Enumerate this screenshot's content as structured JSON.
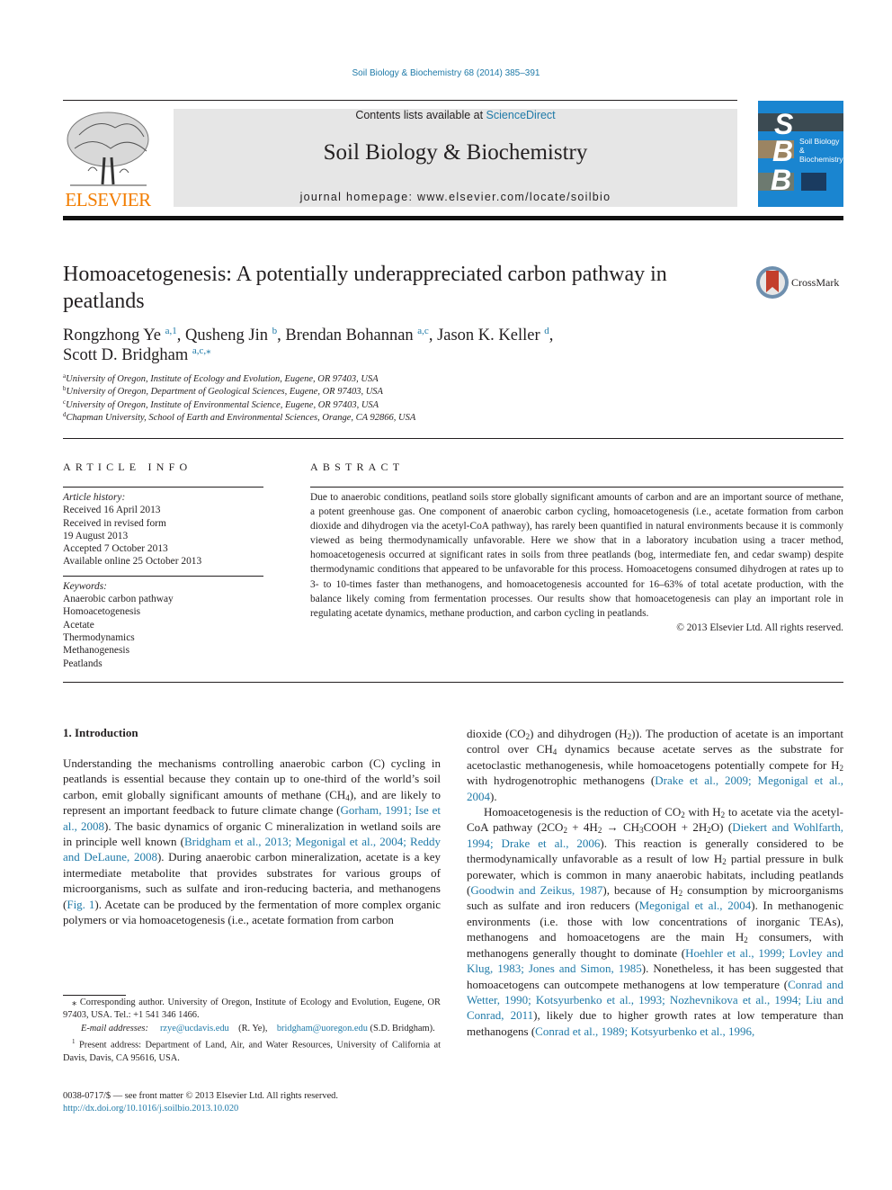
{
  "journal_citation": "Soil Biology & Biochemistry 68 (2014) 385–391",
  "header": {
    "contents_prefix": "Contents lists available at ",
    "contents_link": "ScienceDirect",
    "journal_title": "Soil Biology & Biochemistry",
    "homepage": "journal homepage: www.elsevier.com/locate/soilbio",
    "publisher": "ELSEVIER",
    "cover": {
      "letters": [
        "S",
        "B",
        "B"
      ],
      "title_line1": "Soil Biology &",
      "title_line2": "Biochemistry",
      "color": "#1a85d0"
    }
  },
  "crossmark_label": "CrossMark",
  "article": {
    "title": "Homoacetogenesis: A potentially underappreciated carbon pathway in peatlands",
    "authors": [
      {
        "name": "Rongzhong Ye",
        "marks": "a,1",
        "sep": ", "
      },
      {
        "name": "Qusheng Jin",
        "marks": "b",
        "sep": ", "
      },
      {
        "name": "Brendan Bohannan",
        "marks": "a,c",
        "sep": ", "
      },
      {
        "name": "Jason K. Keller",
        "marks": "d",
        "sep": ","
      },
      {
        "name": "Scott D. Bridgham",
        "marks": "a,c,⁎",
        "sep": ""
      }
    ],
    "affiliations": [
      {
        "mark": "a",
        "text": "University of Oregon, Institute of Ecology and Evolution, Eugene, OR 97403, USA"
      },
      {
        "mark": "b",
        "text": "University of Oregon, Department of Geological Sciences, Eugene, OR 97403, USA"
      },
      {
        "mark": "c",
        "text": "University of Oregon, Institute of Environmental Science, Eugene, OR 97403, USA"
      },
      {
        "mark": "d",
        "text": "Chapman University, School of Earth and Environmental Sciences, Orange, CA 92866, USA"
      }
    ]
  },
  "article_info": {
    "heading": "ARTICLE INFO",
    "history_label": "Article history:",
    "history": [
      "Received 16 April 2013",
      "Received in revised form",
      "19 August 2013",
      "Accepted 7 October 2013",
      "Available online 25 October 2013"
    ],
    "keywords_label": "Keywords:",
    "keywords": [
      "Anaerobic carbon pathway",
      "Homoacetogenesis",
      "Acetate",
      "Thermodynamics",
      "Methanogenesis",
      "Peatlands"
    ]
  },
  "abstract": {
    "heading": "ABSTRACT",
    "text": "Due to anaerobic conditions, peatland soils store globally significant amounts of carbon and are an important source of methane, a potent greenhouse gas. One component of anaerobic carbon cycling, homoacetogenesis (i.e., acetate formation from carbon dioxide and dihydrogen via the acetyl-CoA pathway), has rarely been quantified in natural environments because it is commonly viewed as being thermodynamically unfavorable. Here we show that in a laboratory incubation using a tracer method, homoacetogenesis occurred at significant rates in soils from three peatlands (bog, intermediate fen, and cedar swamp) despite thermodynamic conditions that appeared to be unfavorable for this process. Homoacetogens consumed dihydrogen at rates up to 3- to 10-times faster than methanogens, and homoacetogenesis accounted for 16–63% of total acetate production, with the balance likely coming from fermentation processes. Our results show that homoacetogenesis can play an important role in regulating acetate dynamics, methane production, and carbon cycling in peatlands.",
    "copyright": "© 2013 Elsevier Ltd. All rights reserved."
  },
  "intro": {
    "heading": "1.  Introduction",
    "p1": [
      {
        "t": "Understanding the mechanisms controlling anaerobic carbon (C) cycling in peatlands is essential because they contain up to one-third of the world’s soil carbon, emit globally significant amounts of methane (CH"
      },
      {
        "sub": "4"
      },
      {
        "t": "), and are likely to represent an important feedback to future climate change ("
      },
      {
        "link": "Gorham, 1991; Ise et al., 2008"
      },
      {
        "t": "). The basic dynamics of organic C mineralization in wetland soils are in principle well known ("
      },
      {
        "link": "Bridgham et al., 2013; Megonigal et al., 2004; Reddy and DeLaune, 2008"
      },
      {
        "t": "). During anaerobic carbon mineralization, acetate is a key intermediate metabolite that provides substrates for various groups of microorganisms, such as sulfate and iron-reducing bacteria, and methanogens ("
      },
      {
        "link": "Fig. 1"
      },
      {
        "t": "). Acetate can be produced by the fermentation of more complex organic polymers or via homoacetogenesis (i.e., acetate formation from carbon"
      }
    ],
    "col2_p1": [
      {
        "t": "dioxide (CO"
      },
      {
        "sub": "2"
      },
      {
        "t": ") and dihydrogen (H"
      },
      {
        "sub": "2"
      },
      {
        "t": ")). The production of acetate is an important control over CH"
      },
      {
        "sub": "4"
      },
      {
        "t": " dynamics because acetate serves as the substrate for acetoclastic methanogenesis, while homoacetogens potentially compete for H"
      },
      {
        "sub": "2"
      },
      {
        "t": " with hydrogenotrophic methanogens ("
      },
      {
        "link": "Drake et al., 2009; Megonigal et al., 2004"
      },
      {
        "t": ")."
      }
    ],
    "col2_p2": [
      {
        "t": "Homoacetogenesis is the reduction of CO"
      },
      {
        "sub": "2"
      },
      {
        "t": " with H"
      },
      {
        "sub": "2"
      },
      {
        "t": " to acetate via the acetyl-CoA pathway (2CO"
      },
      {
        "sub": "2"
      },
      {
        "t": " + 4H"
      },
      {
        "sub": "2"
      },
      {
        "t": " → CH"
      },
      {
        "sub": "3"
      },
      {
        "t": "COOH + 2H"
      },
      {
        "sub": "2"
      },
      {
        "t": "O) ("
      },
      {
        "link": "Diekert and Wohlfarth, 1994; Drake et al., 2006"
      },
      {
        "t": "). This reaction is generally considered to be thermodynamically unfavorable as a result of low H"
      },
      {
        "sub": "2"
      },
      {
        "t": " partial pressure in bulk porewater, which is common in many anaerobic habitats, including peatlands ("
      },
      {
        "link": "Goodwin and Zeikus, 1987"
      },
      {
        "t": "), because of H"
      },
      {
        "sub": "2"
      },
      {
        "t": " consumption by microorganisms such as sulfate and iron reducers ("
      },
      {
        "link": "Megonigal et al., 2004"
      },
      {
        "t": "). In methanogenic environments (i.e. those with low concentrations of inorganic TEAs), methanogens and homoacetogens are the main H"
      },
      {
        "sub": "2"
      },
      {
        "t": " consumers, with methanogens generally thought to dominate ("
      },
      {
        "link": "Hoehler et al., 1999; Lovley and Klug, 1983; Jones and Simon, 1985"
      },
      {
        "t": "). Nonetheless, it has been suggested that homoacetogens can outcompete methanogens at low temperature ("
      },
      {
        "link": "Conrad and Wetter, 1990; Kotsyurbenko et al., 1993; Nozhevnikova et al., 1994; Liu and Conrad, 2011"
      },
      {
        "t": "), likely due to higher growth rates at low temperature than methanogens ("
      },
      {
        "link": "Conrad et al., 1989; Kotsyurbenko et al., 1996,"
      }
    ]
  },
  "footnotes": {
    "corresponding": "⁎ Corresponding author. University of Oregon, Institute of Ecology and Evolution, Eugene, OR 97403, USA. Tel.: +1 541 346 1466.",
    "email_label": "E-mail addresses:",
    "email1": "rzye@ucdavis.edu",
    "email1_owner": "(R. Ye),",
    "email2": "bridgham@uoregon.edu",
    "email2_owner": "(S.D. Bridgham).",
    "present_mark": "1",
    "present_address": "Present address: Department of Land, Air, and Water Resources, University of California at Davis, Davis, CA 95616, USA."
  },
  "front_matter": {
    "issn_line": "0038-0717/$ — see front matter © 2013 Elsevier Ltd. All rights reserved.",
    "doi": "http://dx.doi.org/10.1016/j.soilbio.2013.10.020"
  },
  "colors": {
    "link": "#1f7aa8",
    "elsevier_orange": "#f27d00",
    "header_band": "#e6e6e6"
  }
}
